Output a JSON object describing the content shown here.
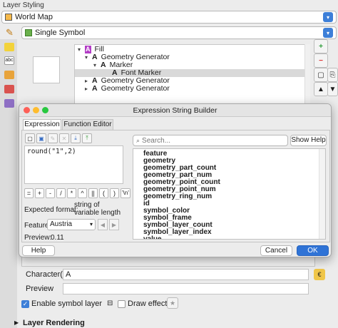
{
  "panel": {
    "title": "Layer Styling",
    "layer": "World Map",
    "renderer": "Single Symbol"
  },
  "symbol_tree": {
    "rows": [
      {
        "label": "Fill",
        "level": 0
      },
      {
        "label": "Geometry Generator",
        "level": 1
      },
      {
        "label": "Marker",
        "level": 2
      },
      {
        "label": "Font Marker",
        "level": 3,
        "selected": true
      },
      {
        "label": "Geometry Generator",
        "level": 1
      },
      {
        "label": "Geometry Generator",
        "level": 1
      }
    ]
  },
  "dialog": {
    "title": "Expression String Builder",
    "tabs": [
      "Expression",
      "Function Editor"
    ],
    "expression": "round(\"1\",2)",
    "operators": [
      "=",
      "+",
      "-",
      "/",
      "*",
      "^",
      "||",
      "(",
      ")",
      "'\\n'"
    ],
    "expected_format_label": "Expected format:",
    "expected_format_value": "string of variable length",
    "feature_label": "Feature",
    "feature_value": "Austria",
    "preview_label": "Preview:",
    "preview_value": "0.11",
    "search_placeholder": "Search...",
    "show_help": "Show Help",
    "functions": [
      "feature",
      "geometry",
      "geometry_part_count",
      "geometry_part_num",
      "geometry_point_count",
      "geometry_point_num",
      "geometry_ring_num",
      "id",
      "symbol_color",
      "symbol_frame",
      "symbol_layer_count",
      "symbol_layer_index",
      "value"
    ],
    "help_button": "Help",
    "cancel_button": "Cancel",
    "ok_button": "OK"
  },
  "properties": {
    "characters_label": "Character(s)",
    "characters_value": "A",
    "preview_label": "Preview",
    "enable_symbol_layer": "Enable symbol layer",
    "draw_effects": "Draw effects",
    "layer_rendering": "Layer Rendering"
  },
  "colors": {
    "accent": "#2f73d6",
    "fill_badge": "#b33dc6"
  }
}
